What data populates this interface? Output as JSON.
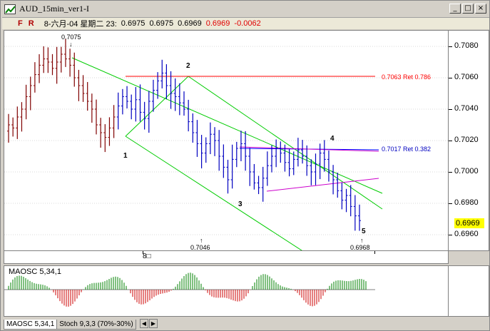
{
  "window": {
    "title": "AUD_15min_ver1-I",
    "buttons": {
      "minimize": "_",
      "maximize": "□",
      "close": "×"
    }
  },
  "infobar": {
    "f_label": "F",
    "r_label": "R",
    "date": "8-六月-04 星期二 23:",
    "open": "0.6975",
    "high": "0.6975",
    "low": "0.6969",
    "close": "0.6969",
    "change": "-0.0062"
  },
  "annotations": {
    "top_high": "0.7075",
    "wave1": "1",
    "wave2": "2",
    "wave3": "3",
    "wave4": "4",
    "wave5": "5",
    "ret786": "0.7063 Ret 0.786",
    "ret382": "0.7017 Ret 0.382",
    "low_mid": "0.7046",
    "low_right": "0.6968"
  },
  "price_axis": {
    "labels": [
      "0.7080",
      "0.7060",
      "0.7040",
      "0.7020",
      "0.7000",
      "0.6980",
      "0.6960"
    ],
    "current": "0.6969"
  },
  "x_axis": {
    "label": "8□"
  },
  "oscillator": {
    "label": "MAOSC 5,34,1"
  },
  "tabs": [
    {
      "label": "MAOSC 5,34,1"
    },
    {
      "label": "Stoch 9,3,3 (70%-30%)"
    }
  ],
  "colors": {
    "down_bar": "#800000",
    "up_bar": "#0000c0",
    "channel": "#00cc00",
    "ret786_line": "#ff0000",
    "ret382_line": "#0000ff",
    "triangle": "#cc00cc",
    "osc_pos": "#008000",
    "osc_neg": "#cc0000"
  },
  "chart_data": {
    "type": "ohlc",
    "ylim": [
      0.695,
      0.709
    ],
    "close_series": [
      0.703,
      0.7028,
      0.7035,
      0.704,
      0.7048,
      0.7055,
      0.7062,
      0.7068,
      0.7072,
      0.707,
      0.7066,
      0.707,
      0.7075,
      0.7072,
      0.7068,
      0.706,
      0.7055,
      0.705,
      0.7045,
      0.704,
      0.703,
      0.7025,
      0.7022,
      0.7028,
      0.7035,
      0.7042,
      0.7048,
      0.7045,
      0.704,
      0.7046,
      0.7038,
      0.7034,
      0.7045,
      0.7052,
      0.7058,
      0.7063,
      0.7055,
      0.705,
      0.7048,
      0.7044,
      0.704,
      0.7032,
      0.7025,
      0.7018,
      0.7012,
      0.7018,
      0.7024,
      0.702,
      0.701,
      0.7003,
      0.6995,
      0.7008,
      0.7015,
      0.7018,
      0.701,
      0.7,
      0.6993,
      0.699,
      0.6996,
      0.7004,
      0.701,
      0.7015,
      0.7012,
      0.7006,
      0.7002,
      0.7008,
      0.7014,
      0.701,
      0.7004,
      0.7,
      0.7005,
      0.7012,
      0.7008,
      0.7,
      0.6995,
      0.6988,
      0.6982,
      0.6985,
      0.6978,
      0.6972,
      0.6969
    ]
  }
}
